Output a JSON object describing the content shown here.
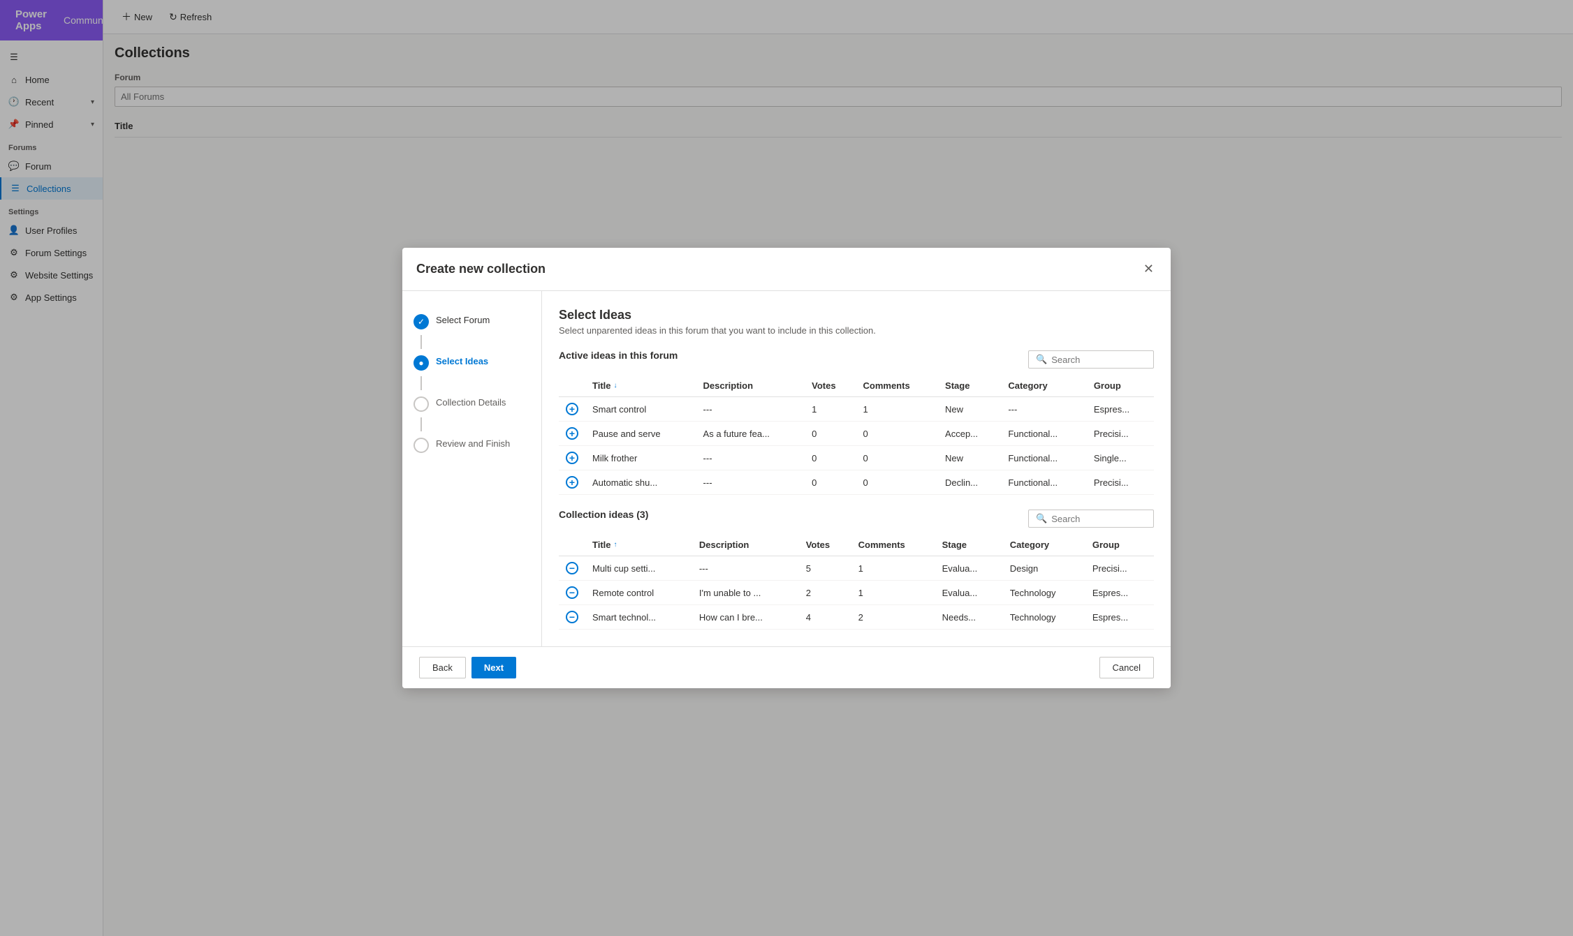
{
  "app": {
    "name": "Power Apps",
    "context": "Community"
  },
  "sidebar": {
    "nav_items": [
      {
        "id": "home",
        "label": "Home",
        "icon": "home"
      },
      {
        "id": "recent",
        "label": "Recent",
        "icon": "recent",
        "hasChevron": true
      },
      {
        "id": "pinned",
        "label": "Pinned",
        "icon": "pin",
        "hasChevron": true
      }
    ],
    "forums_section": "Forums",
    "forums_items": [
      {
        "id": "forum",
        "label": "Forum",
        "icon": "forum"
      },
      {
        "id": "collections",
        "label": "Collections",
        "icon": "collections",
        "active": true
      }
    ],
    "settings_section": "Settings",
    "settings_items": [
      {
        "id": "user-profiles",
        "label": "User Profiles",
        "icon": "user"
      },
      {
        "id": "forum-settings",
        "label": "Forum Settings",
        "icon": "settings"
      },
      {
        "id": "website-settings",
        "label": "Website Settings",
        "icon": "settings"
      },
      {
        "id": "app-settings",
        "label": "App Settings",
        "icon": "settings"
      }
    ]
  },
  "toolbar": {
    "new_label": "New",
    "refresh_label": "Refresh"
  },
  "collections_page": {
    "title": "Collections",
    "forum_label": "Forum",
    "forum_placeholder": "All Forums",
    "table_header": "Title"
  },
  "modal": {
    "title": "Create new collection",
    "steps": [
      {
        "id": "select-forum",
        "label": "Select Forum",
        "state": "completed"
      },
      {
        "id": "select-ideas",
        "label": "Select Ideas",
        "state": "active"
      },
      {
        "id": "collection-details",
        "label": "Collection Details",
        "state": "inactive"
      },
      {
        "id": "review-finish",
        "label": "Review and Finish",
        "state": "inactive"
      }
    ],
    "content": {
      "title": "Select Ideas",
      "description": "Select unparented ideas in this forum that you want to include in this collection.",
      "active_section_title": "Active ideas in this forum",
      "collection_section_title": "Collection ideas (3)",
      "search_placeholder": "Search",
      "active_table": {
        "columns": [
          "Title",
          "Description",
          "Votes",
          "Comments",
          "Stage",
          "Category",
          "Group"
        ],
        "title_sort": "↓",
        "rows": [
          {
            "title": "Smart control",
            "description": "---",
            "votes": "1",
            "comments": "1",
            "stage": "New",
            "category": "---",
            "group": "Espres...",
            "action": "add"
          },
          {
            "title": "Pause and serve",
            "description": "As a future fea...",
            "votes": "0",
            "comments": "0",
            "stage": "Accep...",
            "category": "Functional...",
            "group": "Precisi...",
            "action": "add"
          },
          {
            "title": "Milk frother",
            "description": "---",
            "votes": "0",
            "comments": "0",
            "stage": "New",
            "category": "Functional...",
            "group": "Single...",
            "action": "add"
          },
          {
            "title": "Automatic shu...",
            "description": "---",
            "votes": "0",
            "comments": "0",
            "stage": "Declin...",
            "category": "Functional...",
            "group": "Precisi...",
            "action": "add"
          }
        ]
      },
      "collection_table": {
        "columns": [
          "Title",
          "Description",
          "Votes",
          "Comments",
          "Stage",
          "Category",
          "Group"
        ],
        "title_sort": "↑",
        "rows": [
          {
            "title": "Multi cup setti...",
            "description": "---",
            "votes": "5",
            "comments": "1",
            "stage": "Evalua...",
            "category": "Design",
            "group": "Precisi...",
            "action": "remove"
          },
          {
            "title": "Remote control",
            "description": "I'm unable to ...",
            "votes": "2",
            "comments": "1",
            "stage": "Evalua...",
            "category": "Technology",
            "group": "Espres...",
            "action": "remove"
          },
          {
            "title": "Smart technol...",
            "description": "How can I bre...",
            "votes": "4",
            "comments": "2",
            "stage": "Needs...",
            "category": "Technology",
            "group": "Espres...",
            "action": "remove"
          }
        ]
      }
    },
    "footer": {
      "back_label": "Back",
      "next_label": "Next",
      "cancel_label": "Cancel"
    }
  }
}
